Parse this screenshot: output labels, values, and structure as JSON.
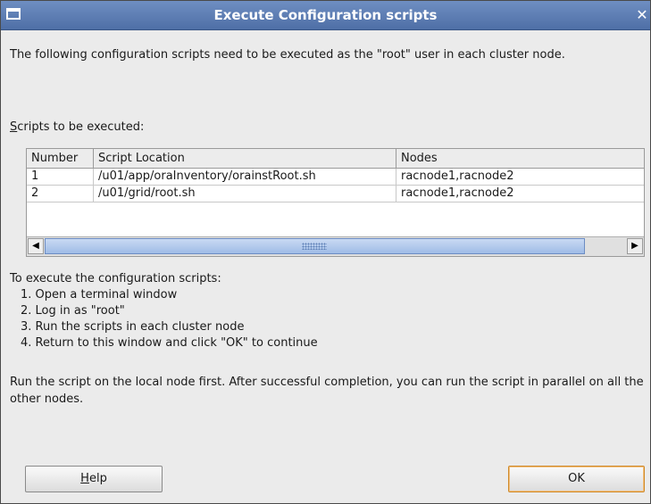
{
  "window": {
    "title": "Execute Configuration scripts"
  },
  "intro_text": "The following configuration scripts need to be executed as the \"root\" user in each cluster node.",
  "scripts_label_mnemonic": "S",
  "scripts_label_rest": "cripts to be executed:",
  "table": {
    "columns": [
      "Number",
      "Script Location",
      "Nodes"
    ],
    "rows": [
      {
        "number": "1",
        "location": "/u01/app/oraInventory/orainstRoot.sh",
        "nodes": "racnode1,racnode2"
      },
      {
        "number": "2",
        "location": "/u01/grid/root.sh",
        "nodes": "racnode1,racnode2"
      }
    ]
  },
  "instructions": {
    "heading": "To execute the configuration scripts:",
    "steps": [
      "1. Open a terminal window",
      "2. Log in as \"root\"",
      "3. Run the scripts in each cluster node",
      "4. Return to this window and click \"OK\" to continue"
    ]
  },
  "note_text": "Run the script on the local node first. After successful completion, you can run the script in parallel on all the other nodes.",
  "buttons": {
    "help_mnemonic": "H",
    "help_rest": "elp",
    "ok_label": "OK"
  },
  "icons": {
    "window": "window-menu-icon",
    "close": "close-icon",
    "scroll_left": "scroll-left-arrow-icon",
    "scroll_right": "scroll-right-arrow-icon"
  },
  "colors": {
    "titlebar": "#5a7ab0",
    "ok_focus_border": "#d08a2a",
    "scroll_thumb": "#b3cbee"
  }
}
